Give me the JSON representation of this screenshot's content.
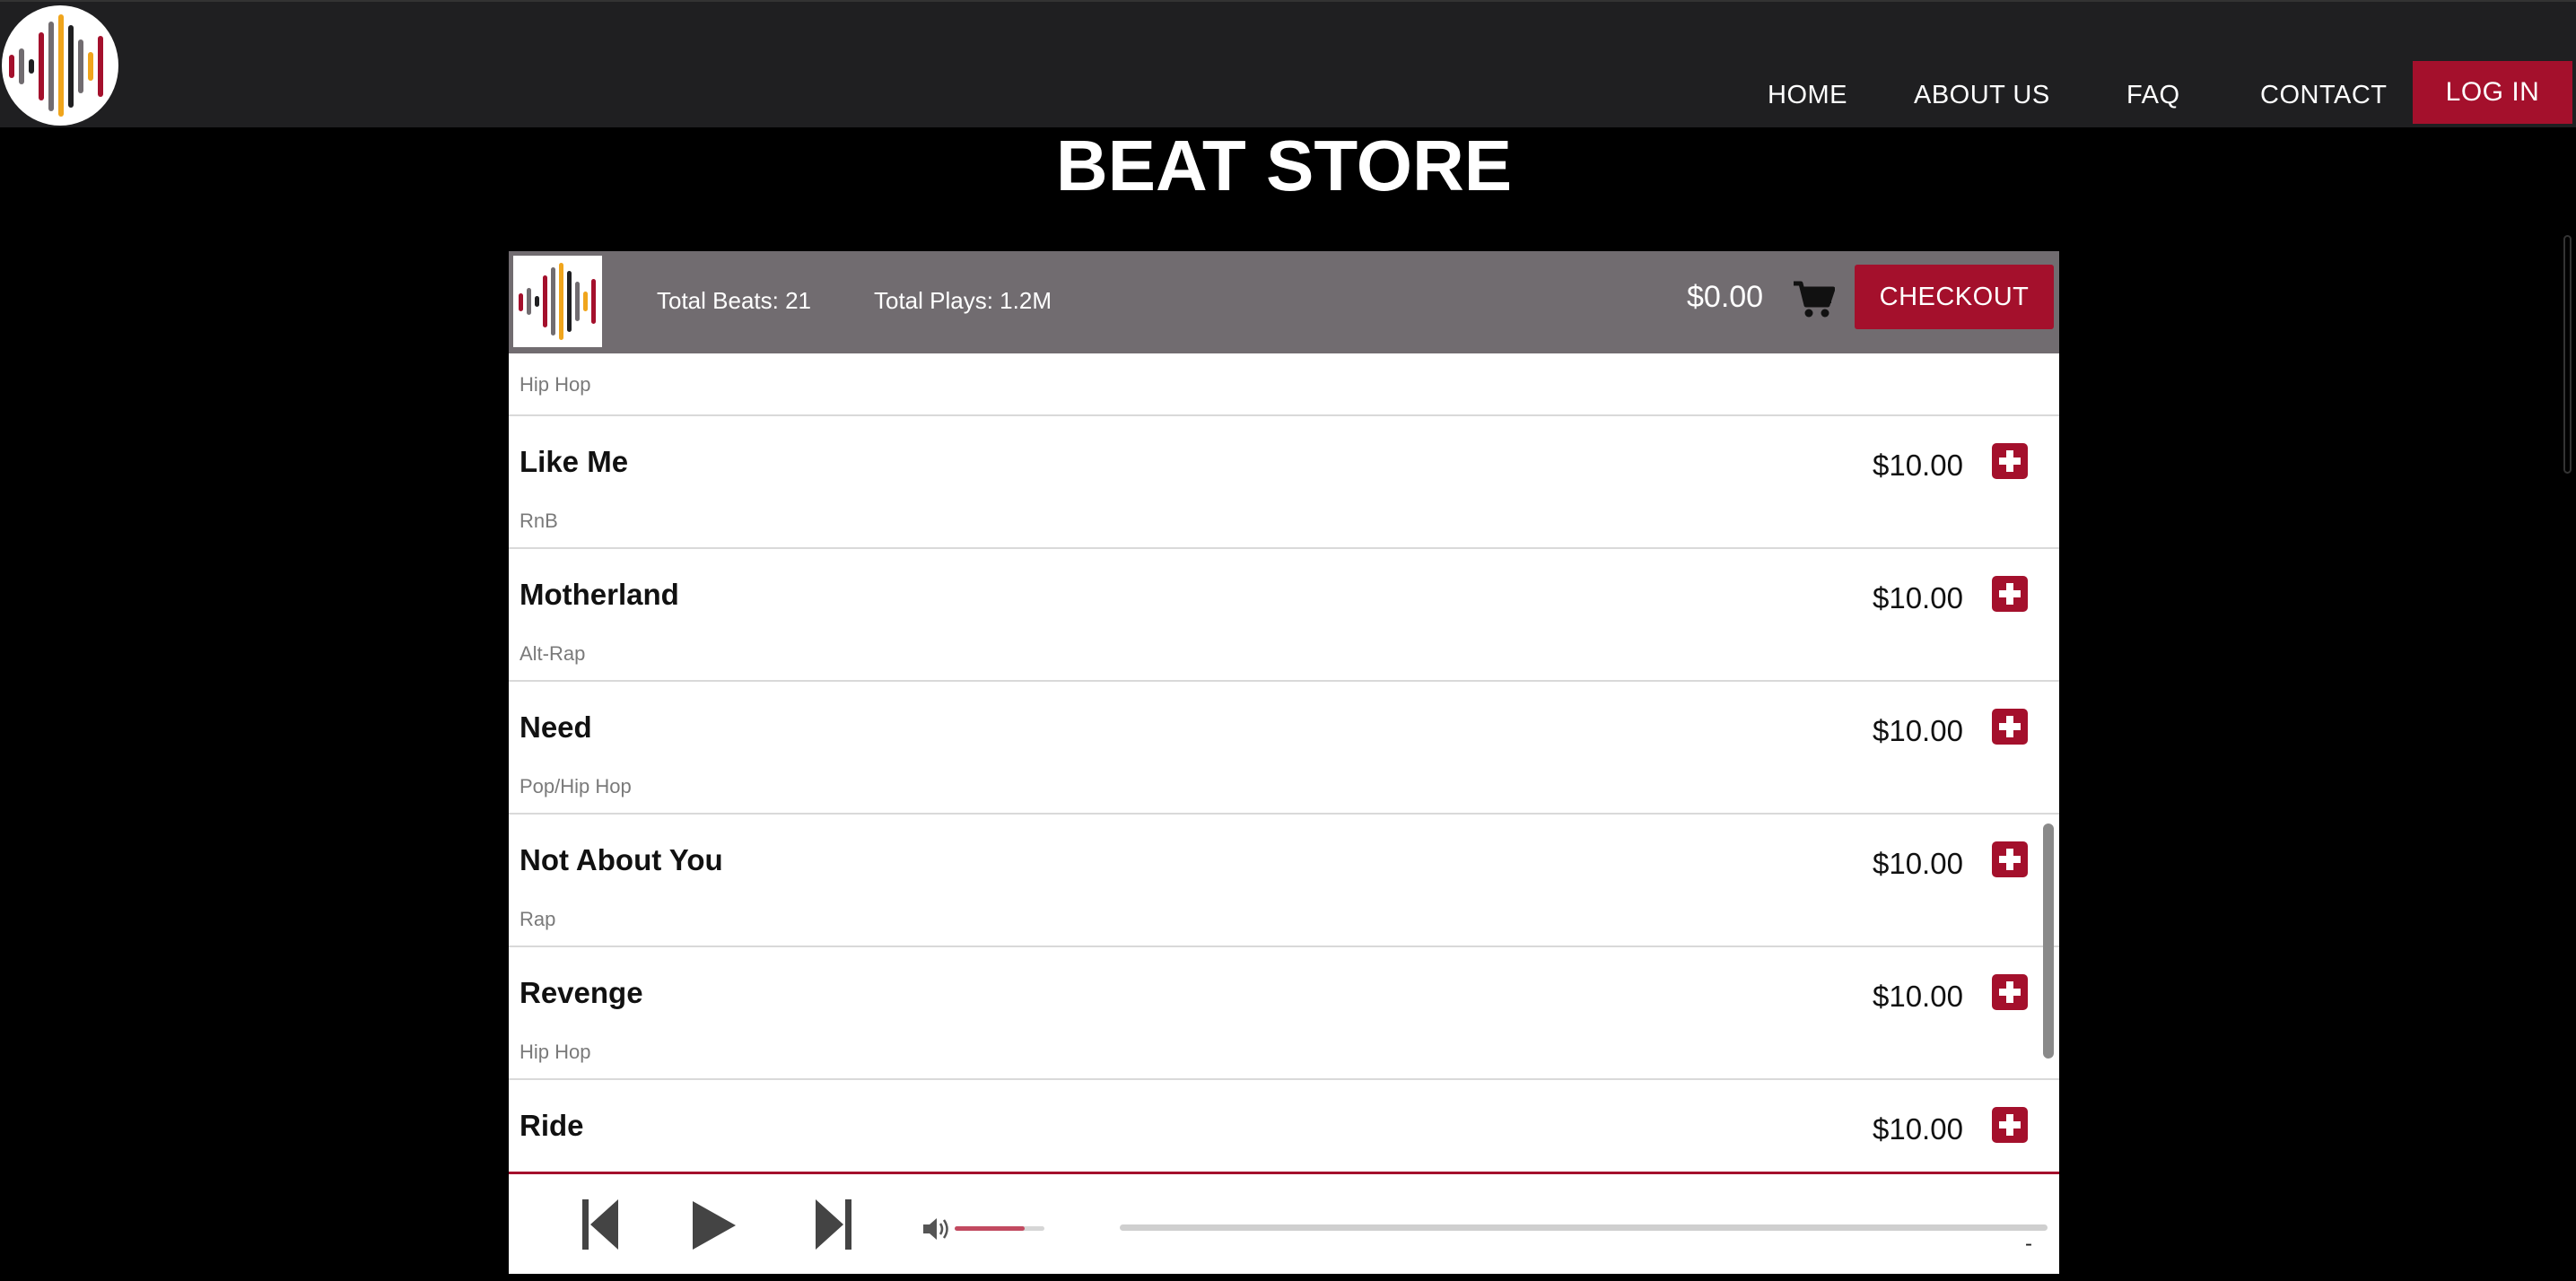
{
  "nav": {
    "links": [
      "HOME",
      "ABOUT US",
      "FAQ",
      "CONTACT"
    ],
    "login_label": "LOG IN"
  },
  "page": {
    "title": "BEAT STORE"
  },
  "store": {
    "total_beats": "Total Beats: 21",
    "total_plays": "Total Plays: 1.2M",
    "cart_total": "$0.00",
    "checkout_label": "CHECKOUT",
    "partial_genre": "Hip Hop",
    "beats": [
      {
        "name": "Like Me",
        "genre": "RnB",
        "price": "$10.00"
      },
      {
        "name": "Motherland",
        "genre": "Alt-Rap",
        "price": "$10.00"
      },
      {
        "name": "Need",
        "genre": "Pop/Hip Hop",
        "price": "$10.00"
      },
      {
        "name": "Not About You",
        "genre": "Rap",
        "price": "$10.00"
      },
      {
        "name": "Revenge",
        "genre": "Hip Hop",
        "price": "$10.00"
      },
      {
        "name": "Ride",
        "genre": "",
        "price": "$10.00"
      }
    ]
  },
  "player": {
    "volume_level": 0.78,
    "progress_level": 0,
    "time": "-"
  },
  "colors": {
    "accent": "#a4102c",
    "navbar": "#1f1f21",
    "store_header": "#716c70"
  },
  "icons": {
    "logo": "sound-wave-logo",
    "cart": "shopping-cart-icon",
    "add": "plus-icon",
    "prev": "skip-previous-icon",
    "play": "play-icon",
    "next": "skip-next-icon",
    "volume": "speaker-icon"
  }
}
